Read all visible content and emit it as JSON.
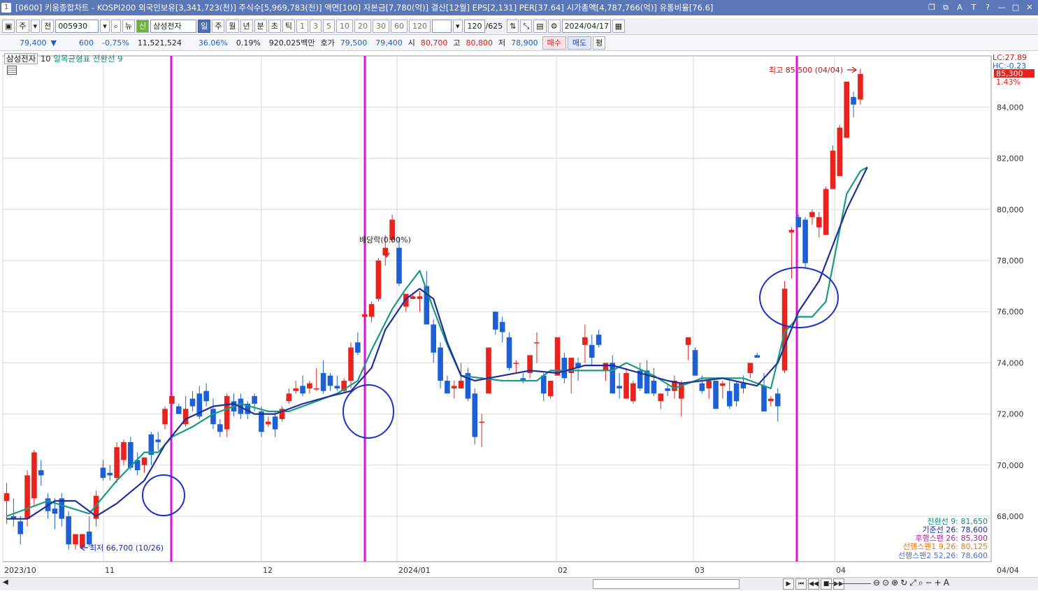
{
  "title_bar": {
    "window_num": "1",
    "title": "[0600] 키움종합차트 - KOSPI200 외국인보유[3,341,723(천)] 주식수[5,969,783(천)] 액면[100] 자본금[7,780(억)] 결산[12월] EPS[2,131] PER[37.64] 시가총액[4,787,766(억)] 유통비율[76.6]",
    "controls": [
      "❐",
      "⧉",
      "A",
      "T",
      "?",
      "—",
      "□",
      "✕"
    ]
  },
  "toolbar": {
    "market": "주",
    "period_type": "전",
    "code": "005930",
    "view_btn": "뉴",
    "credit_badge": "신",
    "stock_name": "삼성전자",
    "periods": [
      "일",
      "주",
      "월",
      "년",
      "분",
      "초",
      "틱"
    ],
    "active_period": "일",
    "minutes": [
      "1",
      "3",
      "5",
      "10",
      "20",
      "30",
      "60",
      "120"
    ],
    "count": "120",
    "total": "/625",
    "date": "2024/04/17"
  },
  "quote": {
    "price": "79,400",
    "arrow": "▼",
    "change": "600",
    "change_pct": "-0.75%",
    "volume": "11,521,524",
    "vol_ratio": "36.06%",
    "turnover": "0.19%",
    "amount": "920,025백만",
    "bid_label": "호가",
    "bid1": "79,500",
    "bid2": "79,400",
    "open_label": "시",
    "open": "80,700",
    "high_label": "고",
    "high": "80,800",
    "low_label": "저",
    "low": "78,900",
    "buy_btn": "매수",
    "sell_btn": "매도",
    "avg_btn": "평"
  },
  "legend": {
    "stock": "삼성전자",
    "period": "10",
    "ichimoku": "일목균형표",
    "conv": "전환선 9"
  },
  "chart_data": {
    "type": "candlestick",
    "ylim": [
      66200,
      86700
    ],
    "y_ticks": [
      68000,
      70000,
      72000,
      74000,
      76000,
      78000,
      80000,
      82000,
      84000
    ],
    "x_labels": [
      "2023/10",
      "11",
      "12",
      "2024/01",
      "02",
      "03",
      "04",
      "04/04"
    ],
    "annotations": {
      "high": "최고 85,500 (04/04)",
      "low": "최저 66,700 (10/26)",
      "dividend": "배당락(0.00%)",
      "lc": "LC:27.89",
      "hc": "HC:-0.23",
      "last": "85,300",
      "last_pct": "1.43%"
    },
    "indicator_values": [
      {
        "label": "전환선 9: 81,650",
        "color": "#128a7b"
      },
      {
        "label": "기준선 26: 78,600",
        "color": "#1c2f9b"
      },
      {
        "label": "후행스팬 26: 85,300",
        "color": "#a52a9b"
      },
      {
        "label": "선행스팬1 9,26: 80,125",
        "color": "#e07a14"
      },
      {
        "label": "선행스팬2 52,26: 78,600",
        "color": "#4a6fd8"
      }
    ],
    "candles": [
      {
        "o": 68600,
        "h": 69300,
        "l": 67700,
        "c": 68900
      },
      {
        "o": 68000,
        "h": 68700,
        "l": 67600,
        "c": 67900
      },
      {
        "o": 67800,
        "h": 68000,
        "l": 66900,
        "c": 67300
      },
      {
        "o": 67900,
        "h": 69800,
        "l": 67600,
        "c": 69600
      },
      {
        "o": 68700,
        "h": 70600,
        "l": 68400,
        "c": 70500
      },
      {
        "o": 69800,
        "h": 70200,
        "l": 69200,
        "c": 69600
      },
      {
        "o": 68700,
        "h": 68900,
        "l": 67900,
        "c": 68200
      },
      {
        "o": 68300,
        "h": 68700,
        "l": 67500,
        "c": 68100
      },
      {
        "o": 68700,
        "h": 68900,
        "l": 67600,
        "c": 67900
      },
      {
        "o": 68000,
        "h": 68200,
        "l": 66700,
        "c": 66900
      },
      {
        "o": 66900,
        "h": 67300,
        "l": 66700,
        "c": 67300
      },
      {
        "o": 66800,
        "h": 67300,
        "l": 66800,
        "c": 67300
      },
      {
        "o": 67400,
        "h": 68000,
        "l": 66800,
        "c": 66900
      },
      {
        "o": 67900,
        "h": 69000,
        "l": 67600,
        "c": 68800
      },
      {
        "o": 69900,
        "h": 70200,
        "l": 69400,
        "c": 69500
      },
      {
        "o": 69700,
        "h": 70000,
        "l": 69400,
        "c": 69600
      },
      {
        "o": 69500,
        "h": 70900,
        "l": 69300,
        "c": 70700
      },
      {
        "o": 70200,
        "h": 71000,
        "l": 70000,
        "c": 70900
      },
      {
        "o": 70900,
        "h": 71100,
        "l": 69800,
        "c": 69900
      },
      {
        "o": 70200,
        "h": 70500,
        "l": 69600,
        "c": 69800
      },
      {
        "o": 70000,
        "h": 70300,
        "l": 69700,
        "c": 70300
      },
      {
        "o": 71200,
        "h": 71300,
        "l": 70000,
        "c": 70400
      },
      {
        "o": 71000,
        "h": 71300,
        "l": 70600,
        "c": 70900
      },
      {
        "o": 71600,
        "h": 72300,
        "l": 71400,
        "c": 72200
      },
      {
        "o": 72400,
        "h": 72800,
        "l": 71900,
        "c": 72700
      },
      {
        "o": 72300,
        "h": 72400,
        "l": 72000,
        "c": 72000
      },
      {
        "o": 71600,
        "h": 72700,
        "l": 71500,
        "c": 72200
      },
      {
        "o": 72600,
        "h": 72900,
        "l": 72100,
        "c": 72300
      },
      {
        "o": 72800,
        "h": 73100,
        "l": 71800,
        "c": 71900
      },
      {
        "o": 72900,
        "h": 73200,
        "l": 72300,
        "c": 72500
      },
      {
        "o": 72200,
        "h": 72600,
        "l": 71400,
        "c": 71600
      },
      {
        "o": 71600,
        "h": 71800,
        "l": 71100,
        "c": 71300
      },
      {
        "o": 71400,
        "h": 72800,
        "l": 71100,
        "c": 72700
      },
      {
        "o": 72500,
        "h": 72800,
        "l": 71900,
        "c": 72100
      },
      {
        "o": 72600,
        "h": 72800,
        "l": 71800,
        "c": 72000
      },
      {
        "o": 72400,
        "h": 72500,
        "l": 71800,
        "c": 72000
      },
      {
        "o": 72700,
        "h": 72800,
        "l": 72100,
        "c": 72400
      },
      {
        "o": 72100,
        "h": 72300,
        "l": 71100,
        "c": 71300
      },
      {
        "o": 71600,
        "h": 71900,
        "l": 71500,
        "c": 71700
      },
      {
        "o": 71900,
        "h": 72100,
        "l": 71100,
        "c": 71400
      },
      {
        "o": 71800,
        "h": 72300,
        "l": 71700,
        "c": 72200
      },
      {
        "o": 72500,
        "h": 73000,
        "l": 72400,
        "c": 72800
      },
      {
        "o": 72900,
        "h": 73300,
        "l": 72800,
        "c": 73000
      },
      {
        "o": 73100,
        "h": 73500,
        "l": 72700,
        "c": 72800
      },
      {
        "o": 73000,
        "h": 73300,
        "l": 72800,
        "c": 73200
      },
      {
        "o": 73000,
        "h": 73800,
        "l": 72900,
        "c": 73000
      },
      {
        "o": 73600,
        "h": 74100,
        "l": 72800,
        "c": 72900
      },
      {
        "o": 73500,
        "h": 73600,
        "l": 72900,
        "c": 73100
      },
      {
        "o": 73100,
        "h": 73500,
        "l": 72900,
        "c": 73000
      },
      {
        "o": 72900,
        "h": 73400,
        "l": 72800,
        "c": 73300
      },
      {
        "o": 73300,
        "h": 74800,
        "l": 73000,
        "c": 74600
      },
      {
        "o": 74800,
        "h": 75200,
        "l": 74300,
        "c": 74400
      },
      {
        "o": 75800,
        "h": 76100,
        "l": 75500,
        "c": 75900
      },
      {
        "o": 75800,
        "h": 76400,
        "l": 75600,
        "c": 76300
      },
      {
        "o": 76500,
        "h": 78100,
        "l": 76400,
        "c": 78000
      },
      {
        "o": 78200,
        "h": 79000,
        "l": 77800,
        "c": 78500
      },
      {
        "o": 78800,
        "h": 79800,
        "l": 78700,
        "c": 79600
      },
      {
        "o": 78500,
        "h": 78900,
        "l": 77000,
        "c": 77100
      },
      {
        "o": 76200,
        "h": 76700,
        "l": 76000,
        "c": 76700
      },
      {
        "o": 76500,
        "h": 76700,
        "l": 76500,
        "c": 76600
      },
      {
        "o": 76500,
        "h": 76800,
        "l": 76000,
        "c": 76600
      },
      {
        "o": 77000,
        "h": 77600,
        "l": 75600,
        "c": 75500
      },
      {
        "o": 75500,
        "h": 75700,
        "l": 74000,
        "c": 74400
      },
      {
        "o": 74600,
        "h": 74800,
        "l": 73000,
        "c": 73300
      },
      {
        "o": 73300,
        "h": 73500,
        "l": 72900,
        "c": 72800
      },
      {
        "o": 73000,
        "h": 73300,
        "l": 72600,
        "c": 73100
      },
      {
        "o": 73000,
        "h": 74000,
        "l": 73000,
        "c": 73300
      },
      {
        "o": 73600,
        "h": 73800,
        "l": 72500,
        "c": 72600
      },
      {
        "o": 72800,
        "h": 73000,
        "l": 70800,
        "c": 71100
      },
      {
        "o": 71700,
        "h": 72000,
        "l": 70700,
        "c": 71700
      },
      {
        "o": 72800,
        "h": 74600,
        "l": 72800,
        "c": 74600
      },
      {
        "o": 76000,
        "h": 76000,
        "l": 75100,
        "c": 75300
      },
      {
        "o": 75600,
        "h": 75800,
        "l": 74800,
        "c": 75200
      },
      {
        "o": 75000,
        "h": 75200,
        "l": 73700,
        "c": 73800
      },
      {
        "o": 74000,
        "h": 74100,
        "l": 73600,
        "c": 74000
      },
      {
        "o": 73400,
        "h": 73600,
        "l": 73200,
        "c": 73300
      },
      {
        "o": 73600,
        "h": 74300,
        "l": 73400,
        "c": 74300
      },
      {
        "o": 74800,
        "h": 75200,
        "l": 74000,
        "c": 74800
      },
      {
        "o": 73500,
        "h": 73600,
        "l": 72500,
        "c": 72800
      },
      {
        "o": 72700,
        "h": 73300,
        "l": 72600,
        "c": 73300
      },
      {
        "o": 73500,
        "h": 75000,
        "l": 73500,
        "c": 75000
      },
      {
        "o": 74200,
        "h": 74400,
        "l": 73200,
        "c": 73400
      },
      {
        "o": 73600,
        "h": 73800,
        "l": 72800,
        "c": 74200
      },
      {
        "o": 74000,
        "h": 74200,
        "l": 73300,
        "c": 73800
      },
      {
        "o": 74700,
        "h": 75500,
        "l": 74000,
        "c": 75000
      },
      {
        "o": 74700,
        "h": 75100,
        "l": 73900,
        "c": 74200
      },
      {
        "o": 75100,
        "h": 75300,
        "l": 74600,
        "c": 74700
      },
      {
        "o": 73700,
        "h": 74000,
        "l": 73300,
        "c": 74000
      },
      {
        "o": 74000,
        "h": 74300,
        "l": 72900,
        "c": 72800
      },
      {
        "o": 73100,
        "h": 73600,
        "l": 72600,
        "c": 73000
      },
      {
        "o": 72600,
        "h": 73800,
        "l": 72600,
        "c": 73600
      },
      {
        "o": 72500,
        "h": 73300,
        "l": 72400,
        "c": 73200
      },
      {
        "o": 73700,
        "h": 74000,
        "l": 72900,
        "c": 73000
      },
      {
        "o": 73700,
        "h": 74100,
        "l": 72800,
        "c": 72800
      },
      {
        "o": 73300,
        "h": 73800,
        "l": 72700,
        "c": 72800
      },
      {
        "o": 72500,
        "h": 72700,
        "l": 72200,
        "c": 72800
      },
      {
        "o": 73000,
        "h": 73200,
        "l": 72700,
        "c": 72900
      },
      {
        "o": 72900,
        "h": 73500,
        "l": 72600,
        "c": 73300
      },
      {
        "o": 72600,
        "h": 73300,
        "l": 71900,
        "c": 73200
      },
      {
        "o": 74700,
        "h": 75000,
        "l": 74100,
        "c": 75000
      },
      {
        "o": 74500,
        "h": 74600,
        "l": 73500,
        "c": 73500
      },
      {
        "o": 73200,
        "h": 73500,
        "l": 72800,
        "c": 72900
      },
      {
        "o": 73000,
        "h": 73300,
        "l": 72600,
        "c": 73300
      },
      {
        "o": 73300,
        "h": 73300,
        "l": 72200,
        "c": 72200
      },
      {
        "o": 73100,
        "h": 73300,
        "l": 72600,
        "c": 73200
      },
      {
        "o": 72900,
        "h": 73300,
        "l": 72200,
        "c": 72300
      },
      {
        "o": 73200,
        "h": 73300,
        "l": 72300,
        "c": 72500
      },
      {
        "o": 73200,
        "h": 73500,
        "l": 72800,
        "c": 73000
      },
      {
        "o": 73600,
        "h": 74000,
        "l": 73400,
        "c": 74000
      },
      {
        "o": 74300,
        "h": 74400,
        "l": 74200,
        "c": 74200
      },
      {
        "o": 73100,
        "h": 73600,
        "l": 72200,
        "c": 72100
      },
      {
        "o": 72500,
        "h": 72700,
        "l": 72300,
        "c": 72600
      },
      {
        "o": 72800,
        "h": 73000,
        "l": 71700,
        "c": 72300
      },
      {
        "o": 73700,
        "h": 77200,
        "l": 73600,
        "c": 76900
      },
      {
        "o": 79100,
        "h": 79300,
        "l": 77300,
        "c": 79200
      },
      {
        "o": 79700,
        "h": 79800,
        "l": 79600,
        "c": 79300
      },
      {
        "o": 79600,
        "h": 79700,
        "l": 77700,
        "c": 77900
      },
      {
        "o": 79700,
        "h": 80000,
        "l": 79400,
        "c": 79900
      },
      {
        "o": 79300,
        "h": 79900,
        "l": 78900,
        "c": 79700
      },
      {
        "o": 79000,
        "h": 80900,
        "l": 79000,
        "c": 80800
      },
      {
        "o": 80800,
        "h": 82500,
        "l": 80800,
        "c": 82300
      },
      {
        "o": 81300,
        "h": 83300,
        "l": 81300,
        "c": 83200
      },
      {
        "o": 82800,
        "h": 85000,
        "l": 82800,
        "c": 85000
      },
      {
        "o": 84400,
        "h": 84600,
        "l": 83600,
        "c": 84100
      },
      {
        "o": 84300,
        "h": 85500,
        "l": 84100,
        "c": 85300
      }
    ],
    "conversion_line": [
      [
        0,
        68000
      ],
      [
        6,
        68600
      ],
      [
        12,
        68100
      ],
      [
        16,
        69400
      ],
      [
        20,
        70500
      ],
      [
        22,
        70500
      ],
      [
        24,
        71100
      ],
      [
        27,
        71500
      ],
      [
        30,
        72000
      ],
      [
        34,
        72400
      ],
      [
        38,
        72100
      ],
      [
        41,
        72100
      ],
      [
        45,
        72500
      ],
      [
        48,
        72800
      ],
      [
        51,
        73300
      ],
      [
        53,
        74500
      ],
      [
        56,
        76100
      ],
      [
        58,
        76900
      ],
      [
        60,
        77600
      ],
      [
        62,
        76100
      ],
      [
        64,
        74700
      ],
      [
        66,
        73500
      ],
      [
        72,
        73300
      ],
      [
        77,
        73300
      ],
      [
        79,
        73700
      ],
      [
        84,
        73700
      ],
      [
        88,
        73700
      ],
      [
        90,
        74000
      ],
      [
        94,
        73500
      ],
      [
        97,
        73000
      ],
      [
        101,
        73400
      ],
      [
        107,
        73400
      ],
      [
        111,
        73000
      ],
      [
        113,
        75200
      ],
      [
        115,
        75800
      ],
      [
        117,
        75800
      ],
      [
        119,
        76400
      ],
      [
        120,
        77800
      ],
      [
        122,
        80600
      ],
      [
        124,
        81500
      ],
      [
        125,
        81650
      ]
    ],
    "base_line": [
      [
        0,
        67900
      ],
      [
        3,
        67900
      ],
      [
        7,
        68600
      ],
      [
        10,
        68600
      ],
      [
        13,
        68000
      ],
      [
        16,
        68500
      ],
      [
        20,
        69400
      ],
      [
        23,
        70800
      ],
      [
        26,
        71800
      ],
      [
        30,
        72300
      ],
      [
        33,
        72400
      ],
      [
        36,
        72000
      ],
      [
        39,
        72000
      ],
      [
        43,
        72400
      ],
      [
        47,
        72700
      ],
      [
        50,
        72900
      ],
      [
        53,
        73800
      ],
      [
        55,
        75300
      ],
      [
        58,
        76500
      ],
      [
        60,
        76900
      ],
      [
        62,
        76500
      ],
      [
        64,
        74800
      ],
      [
        66,
        73500
      ],
      [
        68,
        73300
      ],
      [
        72,
        73500
      ],
      [
        76,
        73700
      ],
      [
        80,
        73600
      ],
      [
        84,
        73900
      ],
      [
        88,
        73900
      ],
      [
        92,
        73600
      ],
      [
        96,
        73300
      ],
      [
        98,
        73200
      ],
      [
        104,
        73400
      ],
      [
        109,
        73100
      ],
      [
        112,
        74000
      ],
      [
        115,
        76000
      ],
      [
        118,
        77200
      ],
      [
        120,
        78600
      ],
      [
        122,
        80000
      ],
      [
        125,
        81650
      ]
    ]
  }
}
